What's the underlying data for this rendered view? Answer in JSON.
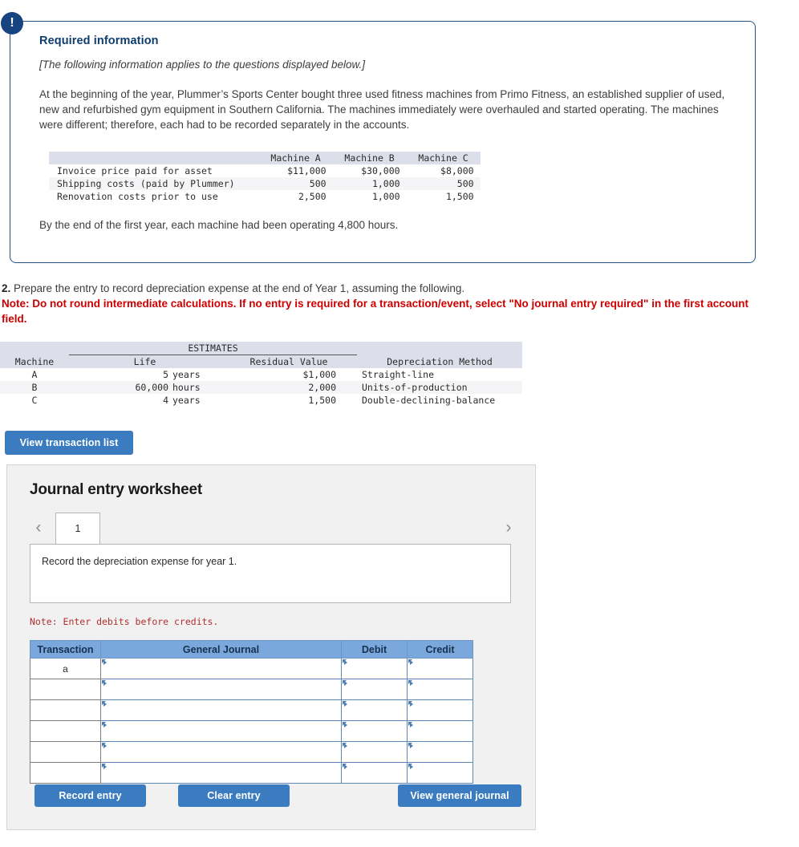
{
  "required_info": {
    "badge_icon": "exclamation-icon",
    "title": "Required information",
    "italic_note": "[The following information applies to the questions displayed below.]",
    "paragraph": "At the beginning of the year, Plummer’s Sports Center bought three used fitness machines from Primo Fitness, an established supplier of used, new and refurbished gym equipment in Southern California. The machines immediately were overhauled and started operating. The machines were different; therefore, each had to be recorded separately in the accounts.",
    "footer": "By the end of the first year, each machine had been operating 4,800 hours.",
    "cost_table": {
      "headers": [
        "",
        "Machine A",
        "Machine B",
        "Machine C"
      ],
      "rows": [
        {
          "label": "Invoice price paid for asset",
          "a": "$11,000",
          "b": "$30,000",
          "c": "$8,000"
        },
        {
          "label": "Shipping costs (paid by Plummer)",
          "a": "500",
          "b": "1,000",
          "c": "500"
        },
        {
          "label": "Renovation costs prior to use",
          "a": "2,500",
          "b": "1,000",
          "c": "1,500"
        }
      ]
    }
  },
  "question": {
    "number": "2.",
    "text": "Prepare the entry to record depreciation expense at the end of Year 1, assuming the following.",
    "note": "Note: Do not round intermediate calculations. If no entry is required for a transaction/event, select \"No journal entry required\" in the first account field."
  },
  "estimates_table": {
    "group_header": "ESTIMATES",
    "headers": [
      "Machine",
      "Life",
      "Residual Value",
      "Depreciation Method"
    ],
    "rows": [
      {
        "machine": "A",
        "life_value": "5",
        "life_unit": "years",
        "residual": "$1,000",
        "method": "Straight-line"
      },
      {
        "machine": "B",
        "life_value": "60,000",
        "life_unit": "hours",
        "residual": "2,000",
        "method": "Units-of-production"
      },
      {
        "machine": "C",
        "life_value": "4",
        "life_unit": "years",
        "residual": "1,500",
        "method": "Double-declining-balance"
      }
    ]
  },
  "buttons": {
    "view_transaction_list": "View transaction list",
    "record_entry": "Record entry",
    "clear_entry": "Clear entry",
    "view_general_journal": "View general journal"
  },
  "worksheet": {
    "title": "Journal entry worksheet",
    "prev_arrow": "‹",
    "next_arrow": "›",
    "tabs": [
      {
        "label": "1",
        "selected": true
      }
    ],
    "description": "Record the depreciation expense for year 1.",
    "debits_note": "Note: Enter debits before credits.",
    "journal": {
      "columns": [
        "Transaction",
        "General Journal",
        "Debit",
        "Credit"
      ],
      "rows": [
        {
          "transaction": "a",
          "general_journal": "",
          "debit": "",
          "credit": ""
        },
        {
          "transaction": "",
          "general_journal": "",
          "debit": "",
          "credit": ""
        },
        {
          "transaction": "",
          "general_journal": "",
          "debit": "",
          "credit": ""
        },
        {
          "transaction": "",
          "general_journal": "",
          "debit": "",
          "credit": ""
        },
        {
          "transaction": "",
          "general_journal": "",
          "debit": "",
          "credit": ""
        },
        {
          "transaction": "",
          "general_journal": "",
          "debit": "",
          "credit": ""
        }
      ]
    }
  },
  "colors": {
    "panel_border": "#1f5288",
    "badge": "#164481",
    "heading": "#0f3d6e",
    "note_red": "#cc0000",
    "button_blue": "#3b7cc0",
    "table_header_blue": "#7aa7dc",
    "mono_header_gray": "#dcdfe9"
  }
}
